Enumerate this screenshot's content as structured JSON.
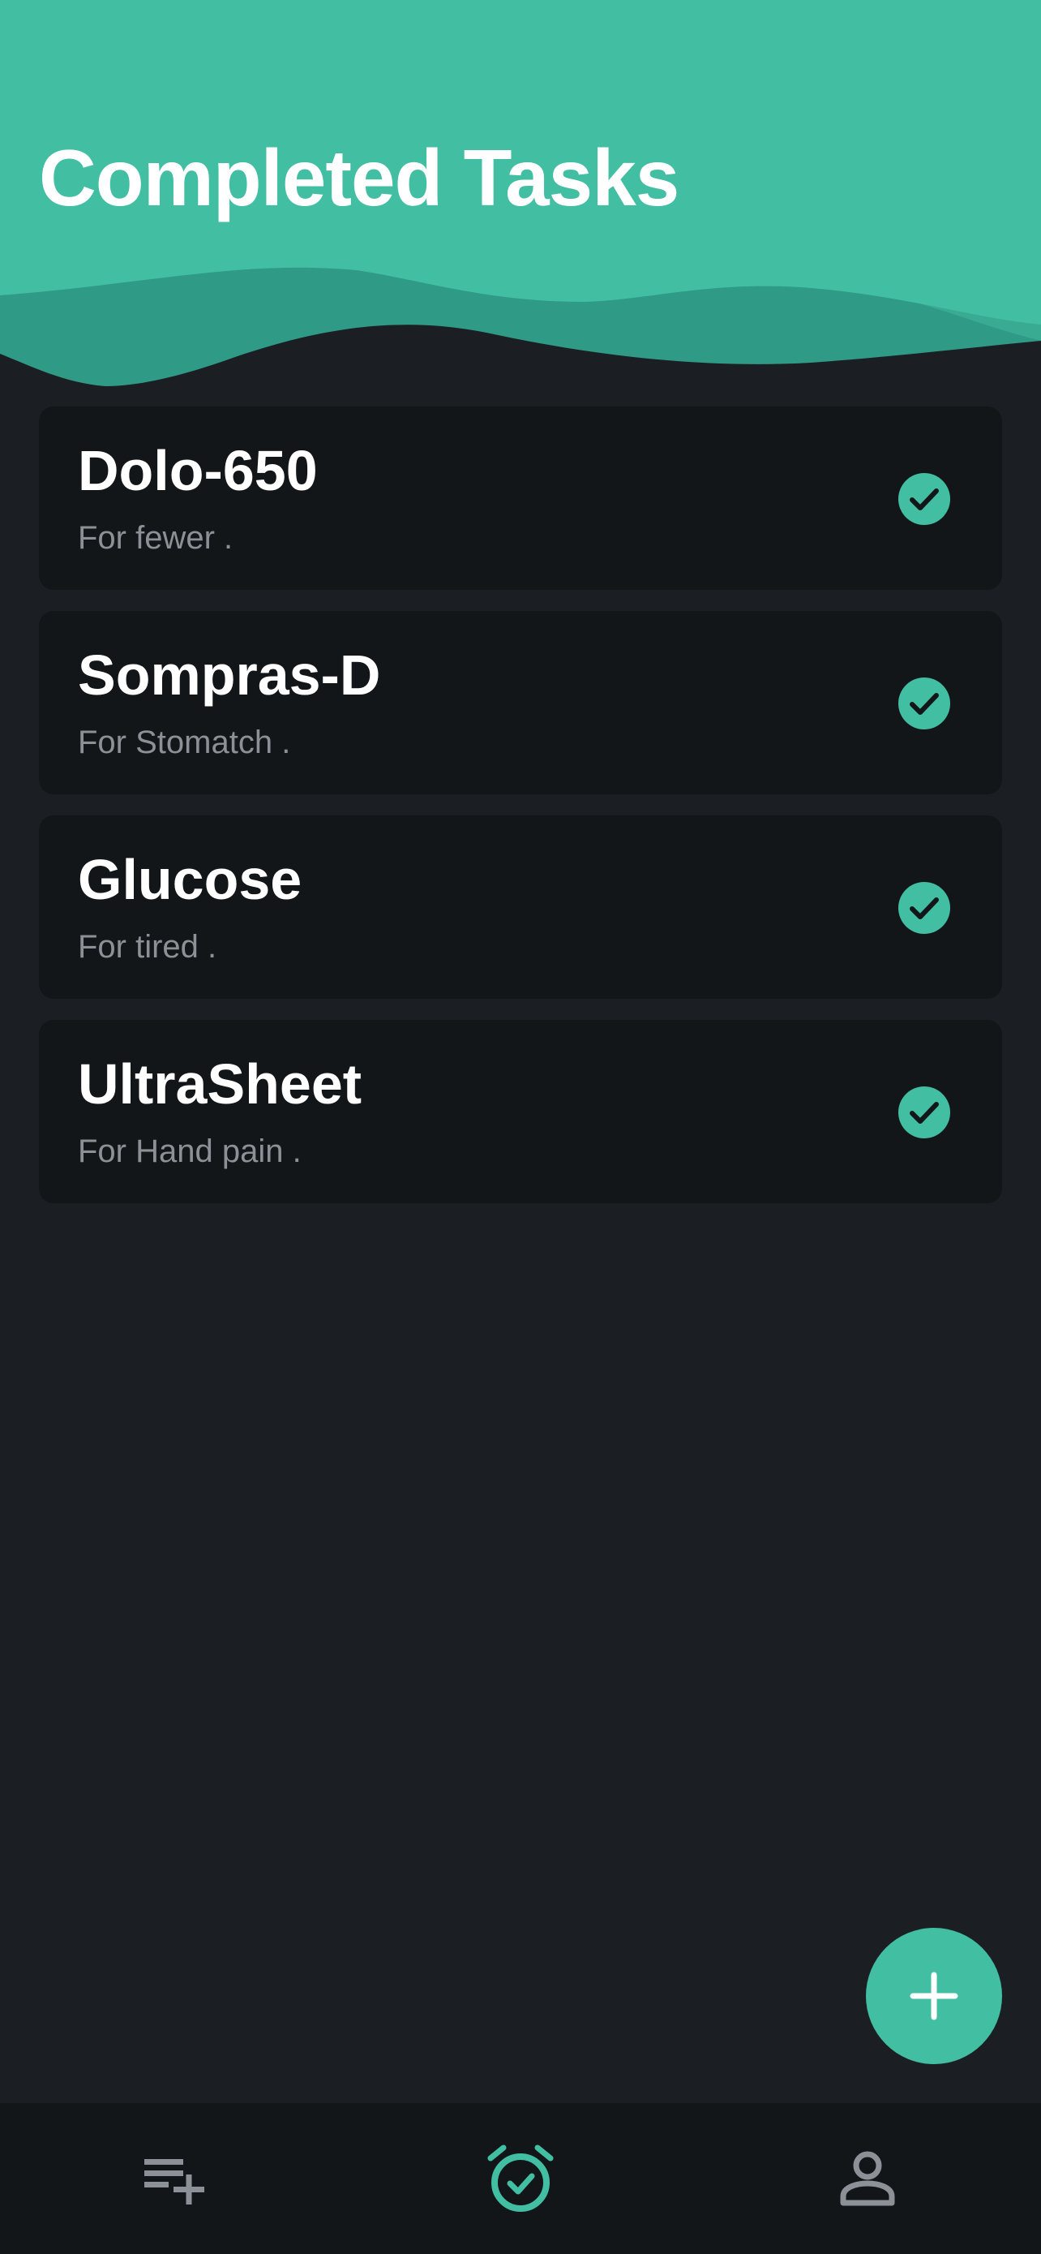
{
  "header": {
    "title": "Completed Tasks"
  },
  "tasks": [
    {
      "name": "Dolo-650",
      "note": "For fewer  .",
      "status": "completed"
    },
    {
      "name": "Sompras-D",
      "note": "For Stomatch  .",
      "status": "completed"
    },
    {
      "name": "Glucose",
      "note": "For tired  .",
      "status": "completed"
    },
    {
      "name": "UltraSheet",
      "note": "For Hand pain  .",
      "status": "completed"
    }
  ],
  "fab": {
    "icon": "plus-icon"
  },
  "bottom_nav": {
    "items": [
      {
        "icon": "playlist-add-icon",
        "active": false
      },
      {
        "icon": "alarm-check-icon",
        "active": true
      },
      {
        "icon": "person-icon",
        "active": false
      }
    ]
  },
  "colors": {
    "accent": "#42bfa3",
    "background": "#1b1f23",
    "card": "#131619",
    "muted_text": "#8b9196",
    "nav_icon_inactive": "#8b9196"
  }
}
